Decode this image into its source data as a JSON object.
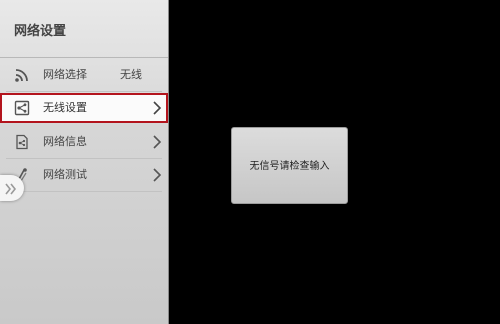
{
  "sidebar": {
    "title": "网络设置",
    "items": [
      {
        "label": "网络选择",
        "value": "无线",
        "icon": "wifi-signal-icon"
      },
      {
        "label": "无线设置",
        "icon": "wireless-settings-icon",
        "selected": true
      },
      {
        "label": "网络信息",
        "icon": "network-info-icon"
      },
      {
        "label": "网络测试",
        "icon": "network-test-icon"
      }
    ]
  },
  "dialog": {
    "message": "无信号请检查输入"
  },
  "colors": {
    "selection_border": "#b3141d",
    "background": "#000000",
    "panel": "#d6d6d6"
  }
}
